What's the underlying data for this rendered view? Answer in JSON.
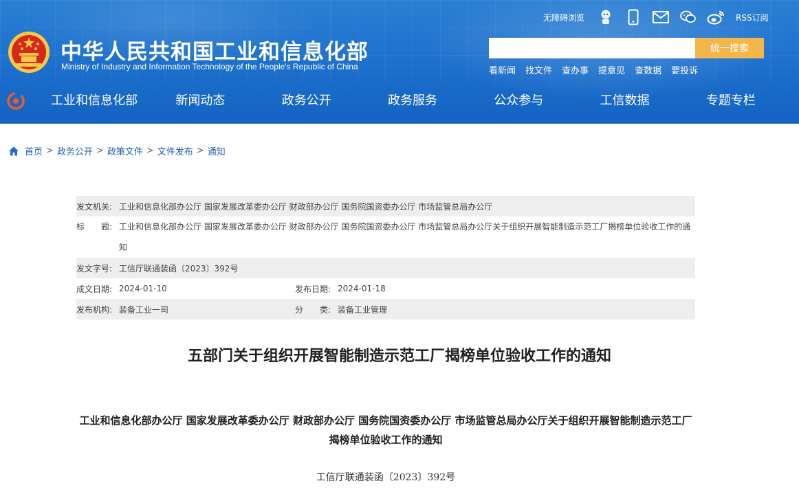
{
  "header": {
    "site_title": "中华人民共和国工业和信息化部",
    "site_subtitle": "Ministry of Industry and Information Technology of the People's Republic of China",
    "accessibility_label": "无障碍浏览",
    "rss_label": "RSS订阅",
    "search": {
      "placeholder": "",
      "button_label": "统一搜索"
    },
    "quick_links": [
      "看新闻",
      "找文件",
      "查办事",
      "提意见",
      "查数据",
      "要投诉"
    ],
    "icons": [
      "robot-icon",
      "mobile-icon",
      "mail-icon",
      "wechat-icon",
      "weibo-icon"
    ],
    "colors": {
      "banner": "#1d6fcc",
      "search_button": "#f2b64a"
    }
  },
  "nav": {
    "items": [
      "工业和信息化部",
      "新闻动态",
      "政务公开",
      "政务服务",
      "公众参与",
      "工信数据",
      "专题专栏"
    ]
  },
  "breadcrumb": {
    "items": [
      "首页",
      "政务公开",
      "政策文件",
      "文件发布",
      "通知"
    ],
    "separator": ">"
  },
  "info": {
    "issuer_label": "发文机关:",
    "issuer_value": "工业和信息化部办公厅 国家发展改革委办公厅 财政部办公厅 国务院国资委办公厅 市场监管总局办公厅",
    "title_label": "标　　题:",
    "title_value": "工业和信息化部办公厅 国家发展改革委办公厅 财政部办公厅 国务院国资委办公厅 市场监管总局办公厅关于组织开展智能制造示范工厂揭榜单位验收工作的通知",
    "doc_no_label": "发文字号:",
    "doc_no_value": "工信厅联通装函〔2023〕392号",
    "created_label": "成文日期:",
    "created_value": "2024-01-10",
    "published_label": "发布日期:",
    "published_value": "2024-01-18",
    "agency_label": "发布机构:",
    "agency_value": "装备工业一司",
    "category_label": "分　　类:",
    "category_value": "装备工业管理"
  },
  "article": {
    "title": "五部门关于组织开展智能制造示范工厂揭榜单位验收工作的通知",
    "heading": "工业和信息化部办公厅  国家发展改革委办公厅  财政部办公厅  国务院国资委办公厅  市场监管总局办公厅关于组织开展智能制造示范工厂揭榜单位验收工作的通知",
    "doc_number": "工信厅联通装函〔2023〕392号"
  }
}
